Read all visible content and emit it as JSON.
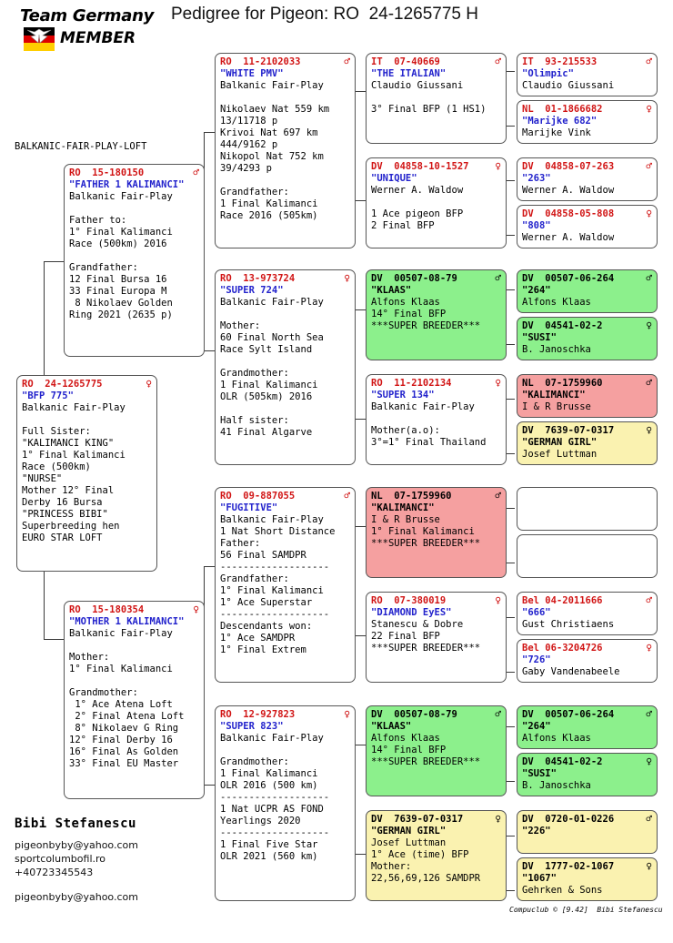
{
  "header": {
    "logo_team": "Team Germany",
    "logo_member": "MEMBER",
    "title": "Pedigree for Pigeon: RO  24-1265775 H"
  },
  "loft_name": "BALKANIC-FAIR-PLAY-LOFT",
  "breeder": {
    "name": "Bibi Stefanescu",
    "email": "pigeonbyby@yahoo.com",
    "website": "sportcolumbofil.ro",
    "phone": "+40723345543",
    "email2": "pigeonbyby@yahoo.com"
  },
  "footer_credit": "Compuclub © [9.42]  Bibi Stefanescu",
  "colors": {
    "ring_red": "#d11515",
    "nick_blue": "#2222cc",
    "green": "#8cf08c",
    "pink": "#f5a0a0",
    "yellow": "#faf2b0"
  },
  "icons": {
    "male": "♂",
    "female": "♀"
  },
  "cards": {
    "subject": {
      "ring": "RO  24-1265775",
      "sex": "♀",
      "nick": "\"BFP 775\"",
      "body": "Balkanic Fair-Play\n\nFull Sister:\n\"KALIMANCI KING\"\n1° Final Kalimanci\nRace (500km)\n\"NURSE\"\nMother 12° Final\nDerby 16 Bursa\n\"PRINCESS BIBI\"\nSuperbreeding hen\nEURO STAR LOFT"
    },
    "father": {
      "ring": "RO  15-180150",
      "sex": "♂",
      "nick": "\"FATHER 1 KALIMANCI\"",
      "body": "Balkanic Fair-Play\n\nFather to:\n1° Final Kalimanci\nRace (500km) 2016\n\nGrandfather:\n12 Final Bursa 16\n33 Final Europa M\n 8 Nikolaev Golden\nRing 2021 (2635 p)"
    },
    "mother": {
      "ring": "RO  15-180354",
      "sex": "♀",
      "nick": "\"MOTHER 1 KALIMANCI\"",
      "body": "Balkanic Fair-Play\n\nMother:\n1° Final Kalimanci\n\nGrandmother:\n 1° Ace Atena Loft\n 2° Final Atena Loft\n 8° Nikolaev G Ring\n12° Final Derby 16\n16° Final As Golden\n33° Final EU Master"
    },
    "gen2": [
      {
        "ring": "RO  11-2102033",
        "sex": "♂",
        "nick": "\"WHITE PMV\"",
        "body": "Balkanic Fair-Play\n\nNikolaev Nat 559 km\n13/11718 p\nKrivoi Nat 697 km\n444/9162 p\nNikopol Nat 752 km\n39/4293 p\n\nGrandfather:\n1 Final Kalimanci\nRace 2016 (505km)"
      },
      {
        "ring": "RO  13-973724",
        "sex": "♀",
        "nick": "\"SUPER 724\"",
        "body": "Balkanic Fair-Play\n\nMother:\n60 Final North Sea\nRace Sylt Island\n\nGrandmother:\n1 Final Kalimanci\nOLR (505km) 2016\n\nHalf sister:\n41 Final Algarve"
      },
      {
        "ring": "RO  09-887055",
        "sex": "♂",
        "nick": "\"FUGITIVE\"",
        "body": "Balkanic Fair-Play\n1 Nat Short Distance\nFather:\n56 Final SAMDPR\n-------------------\nGrandfather:\n1° Final Kalimanci\n1° Ace Superstar\n-------------------\nDescendants won:\n1° Ace SAMDPR\n1° Final Extrem"
      },
      {
        "ring": "RO  12-927823",
        "sex": "♀",
        "nick": "\"SUPER 823\"",
        "body": "Balkanic Fair-Play\n\nGrandmother:\n1 Final Kalimanci\nOLR 2016 (500 km)\n-------------------\n1 Nat UCPR AS FOND\nYearlings 2020\n-------------------\n1 Final Five Star\nOLR 2021 (560 km)"
      }
    ],
    "gen3": [
      {
        "tint": "",
        "ring": "IT  07-40669",
        "sex": "♂",
        "nick": "\"THE ITALIAN\"",
        "body": "Claudio Giussani\n\n3° Final BFP (1 HS1)"
      },
      {
        "tint": "",
        "ring": "DV  04858-10-1527",
        "sex": "♀",
        "nick": "\"UNIQUE\"",
        "body": "Werner A. Waldow\n\n1 Ace pigeon BFP\n2 Final BFP"
      },
      {
        "tint": "green",
        "ring": "DV  00507-08-79",
        "sex": "♂",
        "nick": "\"KLAAS\"",
        "body": "Alfons Klaas\n14° Final BFP\n***SUPER BREEDER***"
      },
      {
        "tint": "",
        "ring": "RO  11-2102134",
        "sex": "♀",
        "nick": "\"SUPER 134\"",
        "body": "Balkanic Fair-Play\n\nMother(a.o):\n3°=1° Final Thailand"
      },
      {
        "tint": "pink",
        "ring": "NL  07-1759960",
        "sex": "♂",
        "nick": "\"KALIMANCI\"",
        "body": "I & R Brusse\n1° Final Kalimanci\n***SUPER BREEDER***"
      },
      {
        "tint": "",
        "ring": "RO  07-380019",
        "sex": "♀",
        "nick": "\"DIAMOND EyES\"",
        "body": "Stanescu & Dobre\n22 Final BFP\n***SUPER BREEDER***"
      },
      {
        "tint": "green",
        "ring": "DV  00507-08-79",
        "sex": "♂",
        "nick": "\"KLAAS\"",
        "body": "Alfons Klaas\n14° Final BFP\n***SUPER BREEDER***"
      },
      {
        "tint": "yellow",
        "ring": "DV  7639-07-0317",
        "sex": "♀",
        "nick": "\"GERMAN GIRL\"",
        "body": "Josef Luttman\n1° Ace (time) BFP\nMother:\n22,56,69,126 SAMDPR"
      }
    ],
    "gen4": [
      {
        "tint": "",
        "ring": "IT  93-215533",
        "sex": "♂",
        "nick": "\"Olimpic\"",
        "body": "Claudio Giussani"
      },
      {
        "tint": "",
        "ring": "NL  01-1866682",
        "sex": "♀",
        "nick": "\"Marijke 682\"",
        "body": "Marijke Vink"
      },
      {
        "tint": "",
        "ring": "DV  04858-07-263",
        "sex": "♂",
        "nick": "\"263\"",
        "body": "Werner A. Waldow"
      },
      {
        "tint": "",
        "ring": "DV  04858-05-808",
        "sex": "♀",
        "nick": "\"808\"",
        "body": "Werner A. Waldow"
      },
      {
        "tint": "green",
        "ring": "DV  00507-06-264",
        "sex": "♂",
        "nick": "\"264\"",
        "body": "Alfons Klaas"
      },
      {
        "tint": "green",
        "ring": "DV  04541-02-2",
        "sex": "♀",
        "nick": "\"SUSI\"",
        "body": "B. Janoschka"
      },
      {
        "tint": "pink",
        "ring": "NL  07-1759960",
        "sex": "♂",
        "nick": "\"KALIMANCI\"",
        "body": "I & R Brusse"
      },
      {
        "tint": "yellow",
        "ring": "DV  7639-07-0317",
        "sex": "♀",
        "nick": "\"GERMAN GIRL\"",
        "body": "Josef Luttman"
      },
      {
        "tint": "",
        "ring": "",
        "sex": "",
        "nick": "",
        "body": ""
      },
      {
        "tint": "",
        "ring": "",
        "sex": "",
        "nick": "",
        "body": ""
      },
      {
        "tint": "",
        "ring": "Bel 04-2011666",
        "sex": "♂",
        "nick": "\"666\"",
        "body": "Gust Christiaens"
      },
      {
        "tint": "",
        "ring": "Bel 06-3204726",
        "sex": "♀",
        "nick": "\"726\"",
        "body": "Gaby Vandenabeele"
      },
      {
        "tint": "green",
        "ring": "DV  00507-06-264",
        "sex": "♂",
        "nick": "\"264\"",
        "body": "Alfons Klaas"
      },
      {
        "tint": "green",
        "ring": "DV  04541-02-2",
        "sex": "♀",
        "nick": "\"SUSI\"",
        "body": "B. Janoschka"
      },
      {
        "tint": "yellow",
        "ring": "DV  0720-01-0226",
        "sex": "♂",
        "nick": "\"226\"",
        "body": ""
      },
      {
        "tint": "yellow",
        "ring": "DV  1777-02-1067",
        "sex": "♀",
        "nick": "\"1067\"",
        "body": "Gehrken & Sons"
      }
    ]
  }
}
